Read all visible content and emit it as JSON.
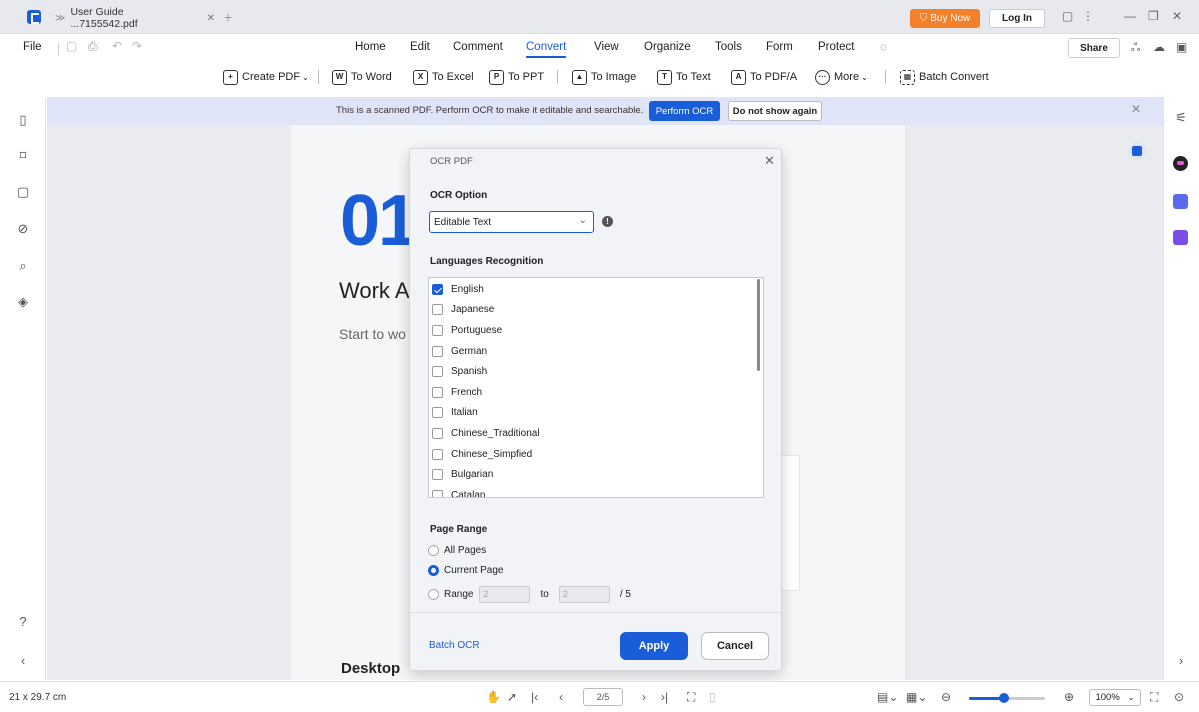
{
  "titlebar": {
    "tab_title": "User Guide ...7155542.pdf",
    "buy_now": "Buy Now",
    "log_in": "Log In"
  },
  "menubar": {
    "file": "File",
    "items": [
      "Home",
      "Edit",
      "Comment",
      "Convert",
      "View",
      "Organize",
      "Tools",
      "Form",
      "Protect"
    ],
    "active": "Convert",
    "share": "Share"
  },
  "toolbar": {
    "create_pdf": "Create PDF",
    "to_word": "To Word",
    "to_excel": "To Excel",
    "to_ppt": "To PPT",
    "to_image": "To Image",
    "to_text": "To Text",
    "to_pdfa": "To PDF/A",
    "more": "More",
    "batch_convert": "Batch Convert"
  },
  "banner": {
    "message": "This is a scanned PDF. Perform OCR to make it editable and searchable.",
    "perform_ocr": "Perform OCR",
    "do_not_show": "Do not show again"
  },
  "document": {
    "chapter_number": "01",
    "heading": "Work A",
    "subtitle": "Start to wo",
    "section": "Desktop"
  },
  "dialog": {
    "title": "OCR PDF",
    "ocr_option_label": "OCR Option",
    "ocr_option_value": "Editable Text",
    "languages_label": "Languages Recognition",
    "languages": [
      {
        "name": "English",
        "checked": true
      },
      {
        "name": "Japanese",
        "checked": false
      },
      {
        "name": "Portuguese",
        "checked": false
      },
      {
        "name": "German",
        "checked": false
      },
      {
        "name": "Spanish",
        "checked": false
      },
      {
        "name": "French",
        "checked": false
      },
      {
        "name": "Italian",
        "checked": false
      },
      {
        "name": "Chinese_Traditional",
        "checked": false
      },
      {
        "name": "Chinese_Simpfied",
        "checked": false
      },
      {
        "name": "Bulgarian",
        "checked": false
      },
      {
        "name": "Catalan",
        "checked": false
      }
    ],
    "page_range_label": "Page Range",
    "all_pages": "All Pages",
    "current_page": "Current Page",
    "range": "Range",
    "range_from": "2",
    "range_to_label": "to",
    "range_to": "2",
    "total_pages": "/ 5",
    "batch_ocr": "Batch OCR",
    "apply": "Apply",
    "cancel": "Cancel"
  },
  "statusbar": {
    "page_size": "21 x 29.7 cm",
    "page_indicator": "2/5",
    "zoom": "100%"
  },
  "colors": {
    "accent": "#1a5dd8",
    "buy_now": "#f4812a",
    "banner_bg": "#dfe5f7"
  }
}
